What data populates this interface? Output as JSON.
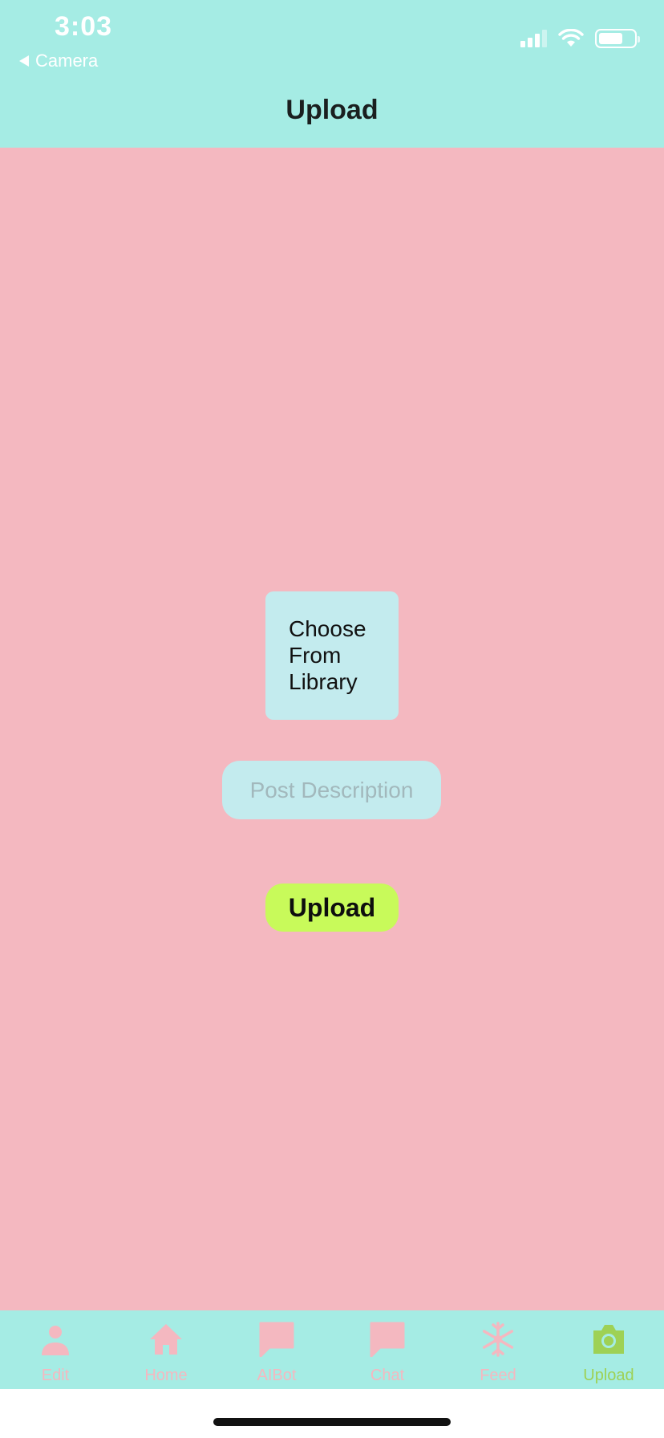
{
  "status_bar": {
    "time": "3:03",
    "back_app": "Camera"
  },
  "nav": {
    "title": "Upload"
  },
  "main": {
    "choose_line1": "Choose",
    "choose_line2": "From",
    "choose_line3": "Library",
    "description_placeholder": "Post Description",
    "upload_label": "Upload"
  },
  "tabs": [
    {
      "label": "Edit",
      "icon": "person-icon",
      "active": false
    },
    {
      "label": "Home",
      "icon": "home-icon",
      "active": false
    },
    {
      "label": "AIBot",
      "icon": "chat-bubble-icon",
      "active": false
    },
    {
      "label": "Chat",
      "icon": "chat-bubble-icon",
      "active": false
    },
    {
      "label": "Feed",
      "icon": "snowflake-icon",
      "active": false
    },
    {
      "label": "Upload",
      "icon": "camera-icon",
      "active": true
    }
  ],
  "colors": {
    "header_bg": "#a5ece4",
    "main_bg": "#f4b8c0",
    "button_bg": "#c3ebee",
    "upload_button_bg": "#c8fa5a",
    "tab_inactive": "#f4b8c0",
    "tab_active": "#9ed155"
  }
}
